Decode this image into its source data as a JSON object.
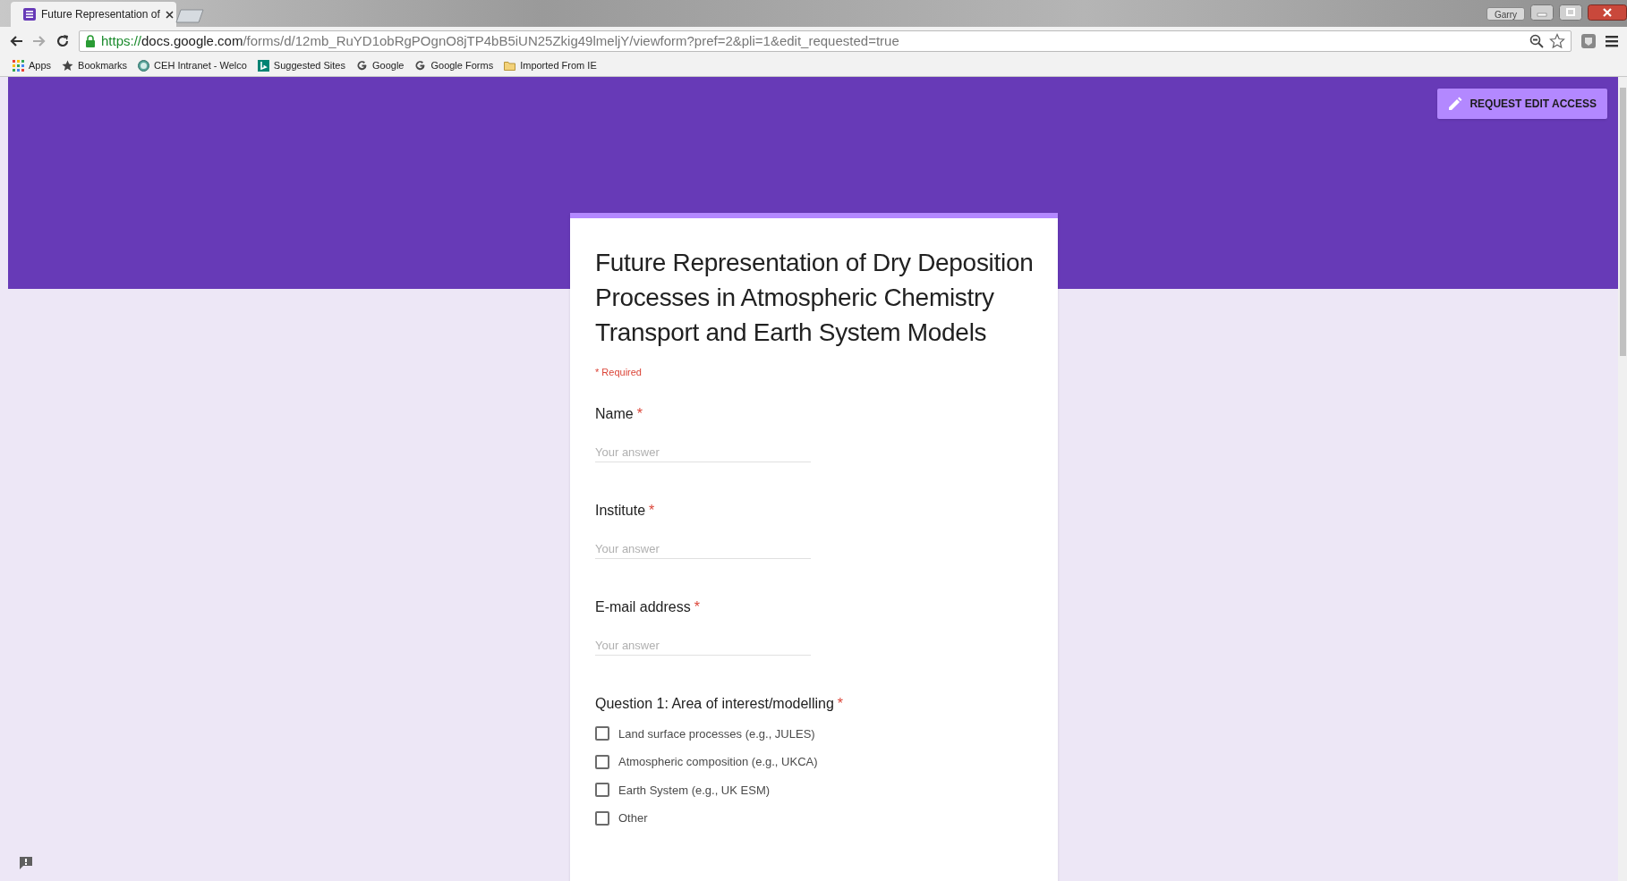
{
  "browser": {
    "tab": {
      "title": "Future Representation of",
      "selected": true
    },
    "profile": "Garry",
    "url": {
      "scheme": "https://",
      "host": "docs.google.com",
      "path": "/forms/d/12mb_RuYD1obRgPOgnO8jTP4bB5iUN25Zkig49lmeljY/viewform?pref=2&pli=1&edit_requested=true"
    },
    "bookmarks": [
      {
        "label": "Apps",
        "kind": "apps"
      },
      {
        "label": "Bookmarks",
        "kind": "star"
      },
      {
        "label": "CEH Intranet - Welco",
        "kind": "globe"
      },
      {
        "label": "Suggested Sites",
        "kind": "bing"
      },
      {
        "label": "Google",
        "kind": "google"
      },
      {
        "label": "Google Forms",
        "kind": "google"
      },
      {
        "label": "Imported From IE",
        "kind": "folder"
      }
    ]
  },
  "header": {
    "button": "REQUEST EDIT ACCESS"
  },
  "form": {
    "title": "Future Representation of Dry Deposition Processes in Atmospheric Chemistry Transport and Earth System Models",
    "required_note": "* Required",
    "required_mark": "*",
    "questions": [
      {
        "label": "Name",
        "required": true,
        "kind": "text",
        "placeholder": "Your answer"
      },
      {
        "label": "Institute",
        "required": true,
        "kind": "text",
        "placeholder": "Your answer"
      },
      {
        "label": "E-mail address",
        "required": true,
        "kind": "text",
        "placeholder": "Your answer"
      },
      {
        "label": "Question 1: Area of interest/modelling",
        "required": true,
        "kind": "checkboxes",
        "options": [
          {
            "label": "Land surface processes (e.g., JULES)",
            "checked": false
          },
          {
            "label": "Atmospheric composition (e.g., UKCA)",
            "checked": false
          },
          {
            "label": "Earth System (e.g., UK ESM)",
            "checked": false
          },
          {
            "label": "Other",
            "checked": false
          }
        ]
      }
    ]
  }
}
